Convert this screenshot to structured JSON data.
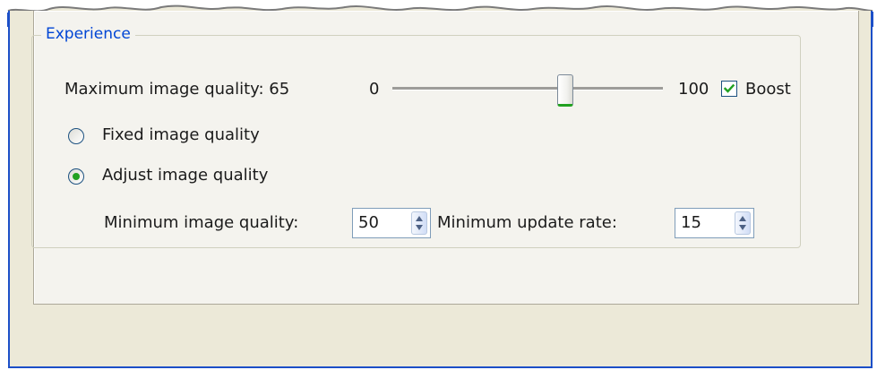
{
  "experience": {
    "group_title": "Experience",
    "max_quality": {
      "label": "Maximum image quality: 65",
      "slider_min_label": "0",
      "slider_max_label": "100",
      "slider_value": 65
    },
    "boost": {
      "label": "Boost",
      "checked": true
    },
    "radios": {
      "fixed_label": "Fixed image quality",
      "adjust_label": "Adjust image quality",
      "selected": "adjust"
    },
    "min_quality": {
      "label": "Minimum image quality:",
      "value": "50"
    },
    "min_update_rate": {
      "label": "Minimum update rate:",
      "value": "15"
    }
  },
  "colors": {
    "window_border": "#1c4fc8",
    "legend_text": "#0046d5",
    "accent_green": "#21a121",
    "dialog_background": "#ece9d8"
  }
}
